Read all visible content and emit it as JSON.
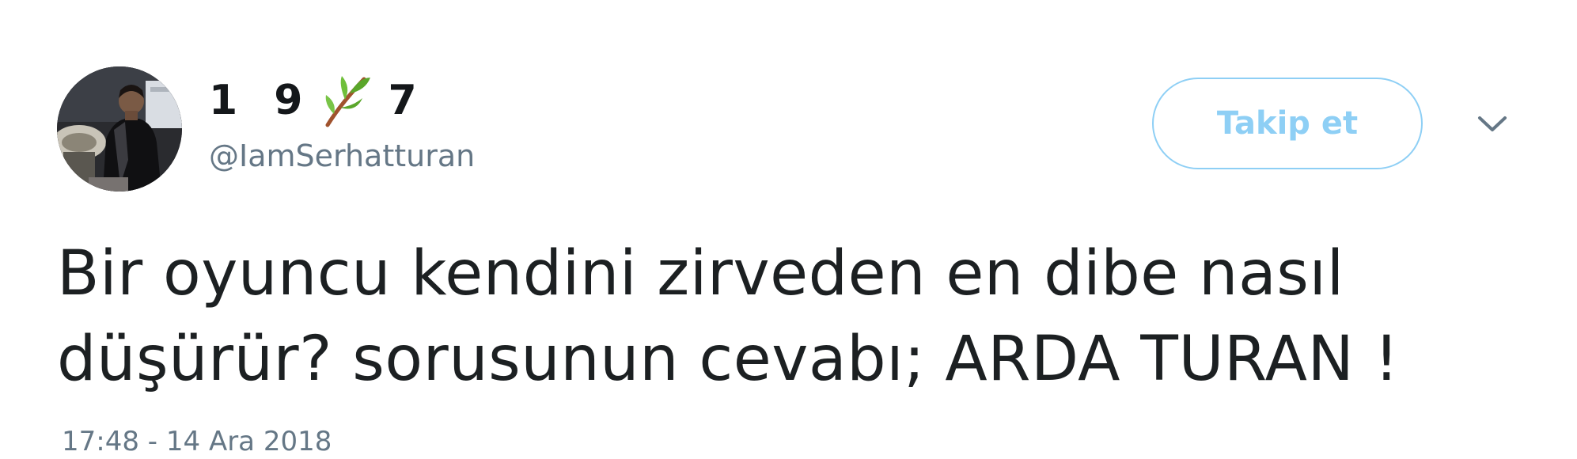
{
  "user": {
    "display_name_part1": "1 9",
    "display_name_emoji": "herb-emoji",
    "display_name_part2": "7",
    "handle": "@IamSerhatturan",
    "avatar_icon": "profile-photo"
  },
  "actions": {
    "follow_label": "Takip et",
    "more_icon": "chevron-down-icon"
  },
  "tweet": {
    "line1": "Bir oyuncu kendini zirveden en dibe nasıl",
    "line2": "düşürür? sorusunun cevabı; ARDA TURAN !",
    "timestamp": "17:48 - 14 Ara 2018"
  },
  "colors": {
    "accent": "#8ecff5",
    "text": "#1c2022",
    "muted": "#657786"
  }
}
